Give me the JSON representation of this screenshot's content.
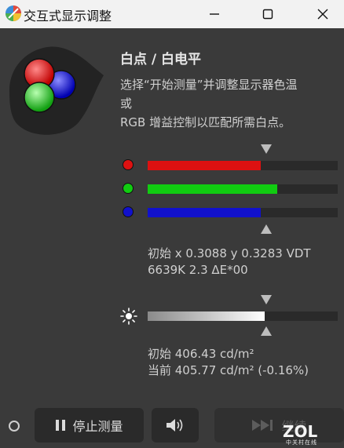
{
  "window": {
    "title": "交互式显示调整"
  },
  "section": {
    "heading": "白点 / 白电平",
    "desc_line1": "选择“开始测量”并调整显示器色温",
    "desc_line2": "或",
    "desc_line3": "RGB 增益控制以匹配所需白点。"
  },
  "channels": [
    {
      "name": "R",
      "color": "#dd1111",
      "level": 0.595
    },
    {
      "name": "G",
      "color": "#11cc11",
      "level": 0.683
    },
    {
      "name": "B",
      "color": "#1111cc",
      "level": 0.595
    }
  ],
  "chromaticity": {
    "line1": "初始 x 0.3088 y 0.3283 VDT",
    "line2": "6639K 2.3 ΔE*00"
  },
  "luminance": {
    "level": 0.616,
    "line1": "初始 406.43 cd/m²",
    "line2": "当前 405.77 cd/m² (-0.16%)"
  },
  "buttons": {
    "stop_label": "停止测量",
    "next_label": "继续"
  },
  "watermark": {
    "brand": "ZOL",
    "sub": "中关村在线"
  }
}
